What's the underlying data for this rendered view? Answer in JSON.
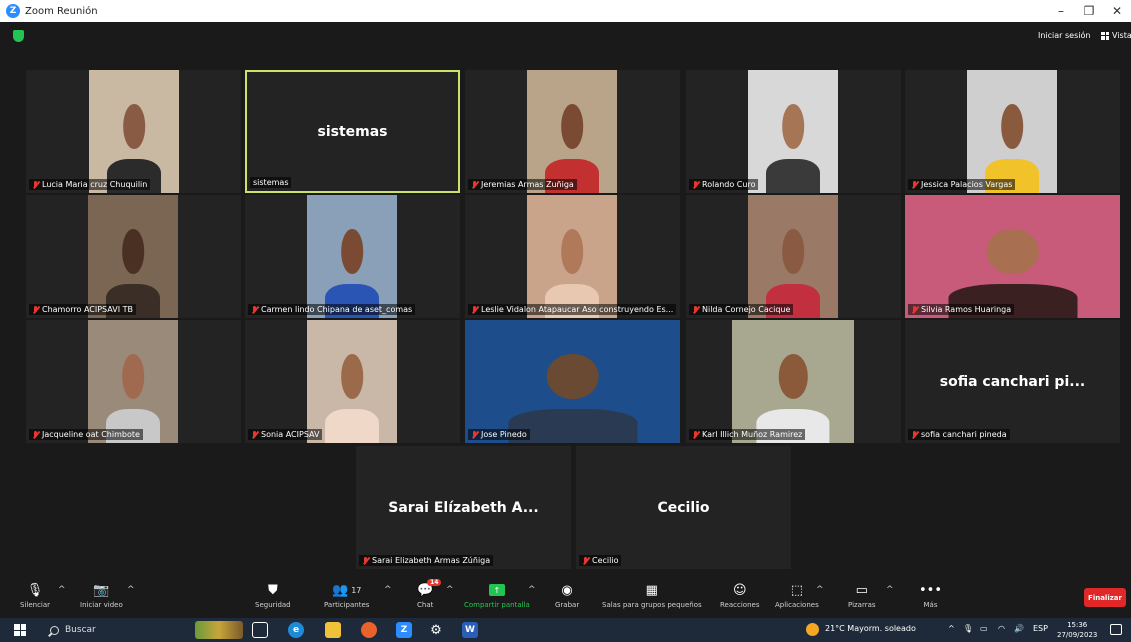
{
  "window": {
    "title": "Zoom Reunión",
    "minimize": "–",
    "maximize": "❐",
    "close": "✕"
  },
  "header": {
    "signin_label": "Iniciar sesión",
    "view_label": "Vista"
  },
  "participants": [
    {
      "name": "Lucia Maria cruz Chuquilin",
      "video": true,
      "muted": true
    },
    {
      "name": "sistemas",
      "big_name": "sistemas",
      "video": false,
      "muted": false,
      "speaking": true
    },
    {
      "name": "Jeremias Armas Zuñiga",
      "video": true,
      "muted": true
    },
    {
      "name": "Rolando Curo",
      "video": true,
      "muted": true
    },
    {
      "name": "Jessica Palacios Vargas",
      "video": true,
      "muted": true
    },
    {
      "name": "Chamorro ACIPSAVI TB",
      "video": true,
      "muted": true
    },
    {
      "name": "Carmen lindo Chipana de aset_comas",
      "video": true,
      "muted": true
    },
    {
      "name": "Leslie Vidalon Atapaucar Aso construyendo Es...",
      "video": true,
      "muted": true
    },
    {
      "name": "Nilda Cornejo Cacique",
      "video": true,
      "muted": true
    },
    {
      "name": "Silvia Ramos  Huaringa",
      "video": true,
      "muted": true
    },
    {
      "name": "Jacqueline oat Chimbote",
      "video": true,
      "muted": true
    },
    {
      "name": "Sonia ACIPSAV",
      "video": true,
      "muted": true
    },
    {
      "name": "Jose Pinedo",
      "video": true,
      "muted": true
    },
    {
      "name": "Karl Illich Muñoz Ramirez",
      "video": true,
      "muted": true
    },
    {
      "name": "sofia canchari pineda",
      "big_name": "sofia canchari pi...",
      "video": false,
      "muted": true
    },
    {
      "name": "Sarai Elizabeth Armas Zúñiga",
      "big_name": "Sarai Elízabeth A...",
      "video": false,
      "muted": true
    },
    {
      "name": "Cecilio",
      "big_name": "Cecilio",
      "video": false,
      "muted": true
    }
  ],
  "toolbar": {
    "mute": "Silenciar",
    "video": "Iniciar video",
    "security": "Seguridad",
    "participants": "Participantes",
    "participants_count": "17",
    "chat": "Chat",
    "chat_badge": "14",
    "share": "Compartir pantalla",
    "record": "Grabar",
    "breakout": "Salas para grupos pequeños",
    "reactions": "Reacciones",
    "apps": "Aplicaciones",
    "whiteboards": "Pizarras",
    "more": "Más",
    "end": "Finalizar"
  },
  "taskbar": {
    "search_placeholder": "Buscar",
    "weather": "21°C  Mayorm. soleado",
    "language": "ESP",
    "time": "15:36",
    "date": "27/09/2023"
  },
  "colors": {
    "accent_green": "#23c552",
    "speaker_border": "#c9e36d",
    "end_red": "#e02828",
    "muted_red": "#e8382e"
  }
}
